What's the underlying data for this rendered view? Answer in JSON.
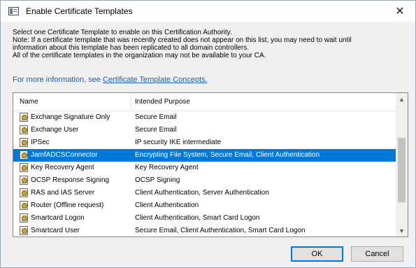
{
  "window": {
    "title": "Enable Certificate Templates",
    "close_glyph": "✕"
  },
  "intro": {
    "line1": "Select one Certificate Template to enable on this Certification Authority.",
    "line2": "Note: If a certificate template that was recently created does not appear on this list, you may need to wait until",
    "line3": "information about this template has been replicated to all domain controllers.",
    "line4": "All of the certificate templates in the organization may not be available to your CA.",
    "more_prefix": "For more information, see ",
    "more_link": "Certificate Template Concepts."
  },
  "list": {
    "columns": [
      "Name",
      "Intended Purpose"
    ],
    "rows": [
      {
        "name": "Exchange Signature Only",
        "purpose": "Secure Email",
        "selected": false
      },
      {
        "name": "Exchange User",
        "purpose": "Secure Email",
        "selected": false
      },
      {
        "name": "IPSec",
        "purpose": "IP security IKE intermediate",
        "selected": false
      },
      {
        "name": "JamfADCSConnector",
        "purpose": "Encrypting File System, Secure Email, Client Authentication",
        "selected": true
      },
      {
        "name": "Key Recovery Agent",
        "purpose": "Key Recovery Agent",
        "selected": false
      },
      {
        "name": "OCSP Response Signing",
        "purpose": "OCSP Signing",
        "selected": false
      },
      {
        "name": "RAS and IAS Server",
        "purpose": "Client Authentication, Server Authentication",
        "selected": false
      },
      {
        "name": "Router (Offline request)",
        "purpose": "Client Authentication",
        "selected": false
      },
      {
        "name": "Smartcard Logon",
        "purpose": "Client Authentication, Smart Card Logon",
        "selected": false
      },
      {
        "name": "Smartcard User",
        "purpose": "Secure Email, Client Authentication, Smart Card Logon",
        "selected": false
      }
    ],
    "icon": "certificate-icon"
  },
  "scrollbar": {
    "up_glyph": "▲",
    "down_glyph": "▼"
  },
  "buttons": {
    "ok": "OK",
    "cancel": "Cancel"
  },
  "colors": {
    "selection": "#0078d7",
    "link": "#1e5aa8"
  }
}
